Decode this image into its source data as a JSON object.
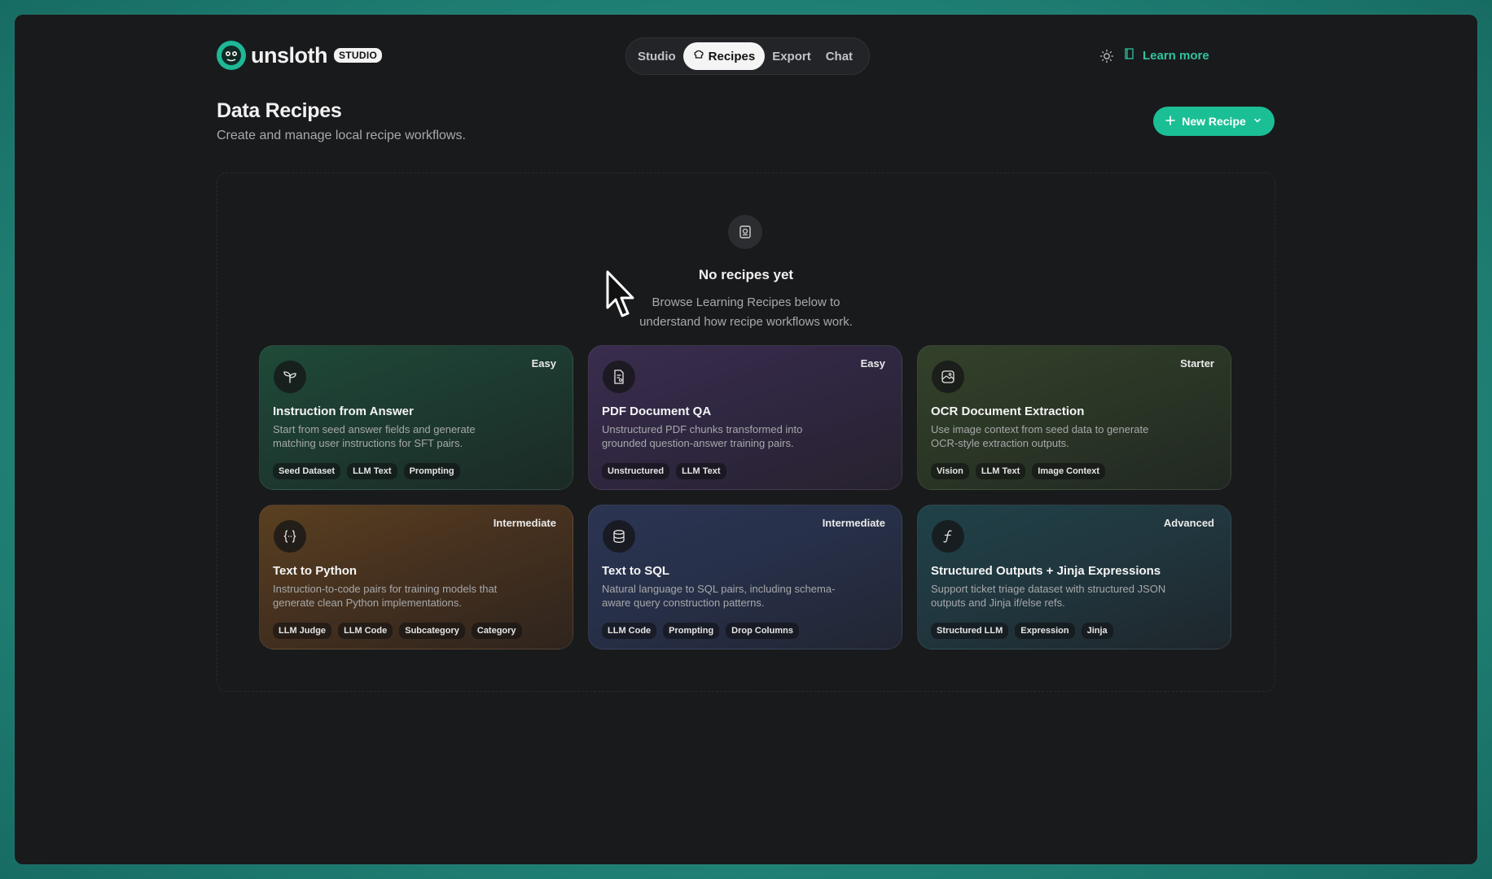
{
  "header": {
    "logo_text": "unsloth",
    "logo_badge": "STUDIO",
    "nav": [
      {
        "label": "Studio",
        "active": false
      },
      {
        "label": "Recipes",
        "active": true
      },
      {
        "label": "Export",
        "active": false
      },
      {
        "label": "Chat",
        "active": false
      }
    ],
    "learn_more": "Learn more"
  },
  "page": {
    "title": "Data Recipes",
    "subtitle": "Create and manage local recipe workflows.",
    "new_recipe": "New Recipe"
  },
  "empty_state": {
    "title": "No recipes yet",
    "description": "Browse Learning Recipes below to understand how recipe workflows work."
  },
  "recipes": [
    {
      "icon": "sprout-icon",
      "level": "Easy",
      "title": "Instruction from Answer",
      "description": "Start from seed answer fields and generate matching user instructions for SFT pairs.",
      "tags": [
        "Seed Dataset",
        "LLM Text",
        "Prompting"
      ]
    },
    {
      "icon": "document-icon",
      "level": "Easy",
      "title": "PDF Document QA",
      "description": "Unstructured PDF chunks transformed into grounded question-answer training pairs.",
      "tags": [
        "Unstructured",
        "LLM Text"
      ]
    },
    {
      "icon": "image-scan-icon",
      "level": "Starter",
      "title": "OCR Document Extraction",
      "description": "Use image context from seed data to generate OCR-style extraction outputs.",
      "tags": [
        "Vision",
        "LLM Text",
        "Image Context"
      ]
    },
    {
      "icon": "code-braces-icon",
      "level": "Intermediate",
      "title": "Text to Python",
      "description": "Instruction-to-code pairs for training models that generate clean Python implementations.",
      "tags": [
        "LLM Judge",
        "LLM Code",
        "Subcategory",
        "Category"
      ]
    },
    {
      "icon": "database-icon",
      "level": "Intermediate",
      "title": "Text to SQL",
      "description": "Natural language to SQL pairs, including schema-aware query construction patterns.",
      "tags": [
        "LLM Code",
        "Prompting",
        "Drop Columns"
      ]
    },
    {
      "icon": "function-icon",
      "level": "Advanced",
      "title": "Structured Outputs + Jinja Expressions",
      "description": "Support ticket triage dataset with structured JSON outputs and Jinja if/else refs.",
      "tags": [
        "Structured LLM",
        "Expression",
        "Jinja"
      ]
    }
  ],
  "colors": {
    "accent": "#1bbf95",
    "background": "#191a1c",
    "frame": "#2a9d8f"
  }
}
